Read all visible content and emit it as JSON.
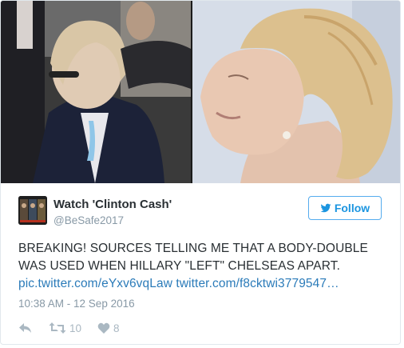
{
  "tweet": {
    "display_name": "Watch 'Clinton Cash'",
    "handle": "@BeSafe2017",
    "follow_label": "Follow",
    "text_line1": "BREAKING! SOURCES TELLING ME THAT A BODY-DOUBLE",
    "text_line2": "WAS USED WHEN HILLARY \"LEFT\" CHELSEAS APART.",
    "link1": "pic.twitter.com/eYxv6vqLaw",
    "link2": "twitter.com/f8cktwi3779547…",
    "timestamp": "10:38 AM - 12 Sep 2016",
    "retweet_count": "10",
    "like_count": "8"
  },
  "icons": {
    "follow": "twitter-bird-icon",
    "reply": "reply-icon",
    "retweet": "retweet-icon",
    "like": "heart-icon"
  },
  "colors": {
    "link": "#2b7bb9",
    "follow_border": "#55acee",
    "text": "#292f33",
    "muted": "#8899a6",
    "action_icons": "#aab8c2"
  }
}
